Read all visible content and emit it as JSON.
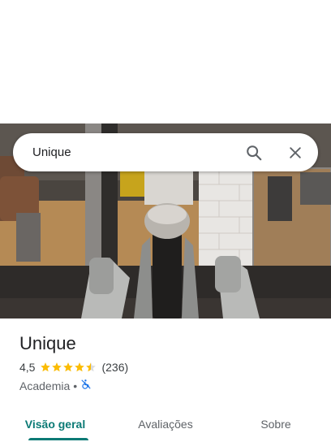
{
  "search": {
    "query": "Unique",
    "search_icon": "search-icon",
    "clear_icon": "close-icon"
  },
  "place": {
    "name": "Unique",
    "rating": "4,5",
    "rating_fraction": 0.9,
    "review_count": "(236)",
    "category": "Academia",
    "separator": "•",
    "accessibility_icon": "no-wheelchair-icon"
  },
  "tabs": [
    {
      "label": "Visão geral",
      "active": true
    },
    {
      "label": "Avaliações",
      "active": false
    },
    {
      "label": "Sobre",
      "active": false
    }
  ],
  "colors": {
    "accent": "#0b7a75",
    "star": "#fbbc04",
    "accessibility": "#1a73e8"
  }
}
